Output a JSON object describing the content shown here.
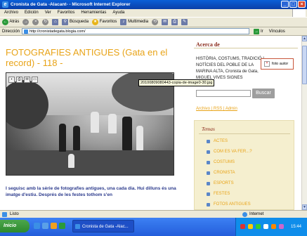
{
  "window": {
    "title": "Cronista de Gata -Alacant- - Microsoft Internet Explorer",
    "buttons": {
      "minimize": "_",
      "maximize": "□",
      "close": "×"
    }
  },
  "menu": [
    "Archivo",
    "Edición",
    "Ver",
    "Favoritos",
    "Herramientas",
    "Ayuda"
  ],
  "toolbar": {
    "back": "Atrás",
    "search": "Búsqueda",
    "favorites": "Favoritos",
    "multimedia": "Multimedia"
  },
  "address": {
    "label": "Dirección",
    "url": "http://cronistadegata.blogia.com/",
    "go": "Ir",
    "links": "Vínculos"
  },
  "post": {
    "title": "FOTOGRAFIES ANTIGUES (Gata en el record) - 118 -",
    "image_tooltip": "20100809080443-copia-de-image0-30.jpg",
    "body": "I seguisc amb la sèrie de fotografies antigues, una cada dia. Hui dilluns és una imatge d'estiu. Després de les festes tothom s'en"
  },
  "sidebar": {
    "heading": "Acerca de",
    "about": "HISTÒRIA, COSTUMS, TRADICIÓ I NOTÍCIES DEL POBLE DE LA MARINA ALTA, Cronista de Gata, MIGUEL VIVES SIGNES",
    "author_image_label": "foto autor",
    "search_button": "Buscar",
    "links": [
      "Archivo",
      "RSS",
      "Admin"
    ],
    "temes": {
      "title": "Temas",
      "items": [
        "ACTES",
        "COM ES VA FER...?",
        "COSTUMS",
        "CRONISTA",
        "ESPORTS",
        "FESTES",
        "FOTOS ANTIGUES"
      ]
    }
  },
  "status": {
    "text": "Listo",
    "zone": "Internet"
  },
  "taskbar": {
    "start": "Inicio",
    "task": "Cronista de Gata -Alac...",
    "clock": "15:44"
  },
  "colors": {
    "accent_orange": "#e8a317",
    "heading_red": "#8a2a1a",
    "body_blue": "#2b3a8c"
  }
}
